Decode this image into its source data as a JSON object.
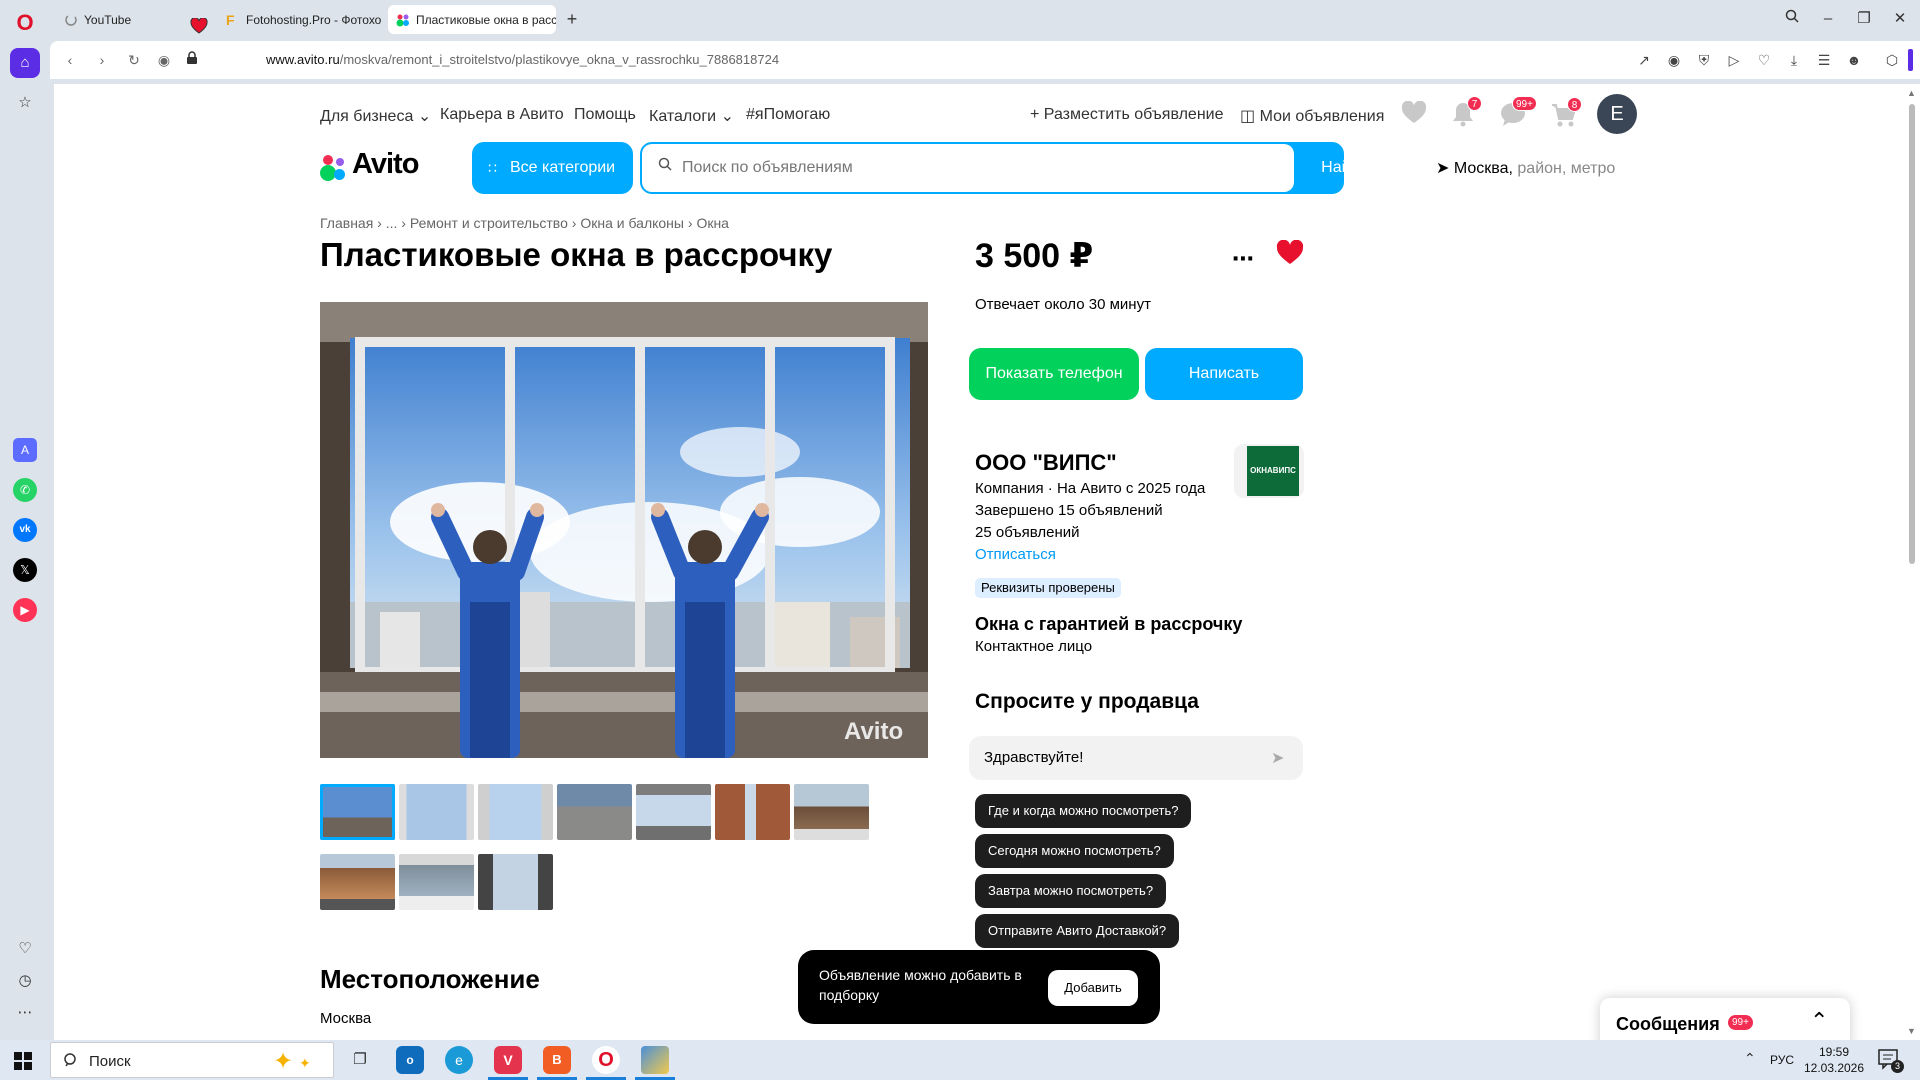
{
  "browser": {
    "tabs": [
      {
        "title": "YouTube"
      },
      {
        "title": "Fotohosting.Pro - Фотохо"
      },
      {
        "title": "Пластиковые окна в расс"
      }
    ],
    "url_domain": "www.avito.ru",
    "url_path": "/moskva/remont_i_stroitelstvo/plastikovye_okna_v_rassrochku_7886818724"
  },
  "header": {
    "nav": [
      "Для бизнеса",
      "Карьера в Авито",
      "Помощь",
      "Каталоги",
      "#яПомогаю"
    ],
    "post_ad": "Разместить объявление",
    "my_ads": "Мои объявления",
    "notifications_count": "7",
    "messages_count": "99+",
    "cart_count": "8",
    "avatar_letter": "E",
    "logo": "Avito",
    "all_categories": "Все категории",
    "search_placeholder": "Поиск по объявлениям",
    "search_button": "Найти",
    "location_city": "Москва,",
    "location_hint": "район, метро"
  },
  "breadcrumbs": [
    "Главная",
    "...",
    "Ремонт и строительство",
    "Окна и балконы",
    "Окна"
  ],
  "listing": {
    "title": "Пластиковые окна в рассрочку",
    "photo_watermark": "Avito",
    "location_heading": "Местоположение",
    "location_city": "Москва"
  },
  "sidebar_info": {
    "price": "3 500 ₽",
    "response_time": "Отвечает около 30 минут",
    "show_phone": "Показать телефон",
    "write": "Написать",
    "seller_name": "ООО \"ВИПС\"",
    "seller_type": "Компания · На Авито с 2025 года",
    "completed": "Завершено 15 объявлений",
    "ads_count": "25 объявлений",
    "unsubscribe": "Отписаться",
    "verified_badge": "Реквизиты проверены",
    "seller_logo_text": "ОКНАВИПС",
    "contact_title": "Окна с гарантией в рассрочку",
    "contact_role": "Контактное лицо",
    "ask_heading": "Спросите у продавца",
    "message_value": "Здравствуйте!",
    "quick_questions": [
      "Где и когда можно посмотреть?",
      "Сегодня можно посмотреть?",
      "Завтра можно посмотреть?",
      "Отправите Авито Доставкой?"
    ]
  },
  "toast": {
    "text": "Объявление можно добавить в подборку",
    "button": "Добавить"
  },
  "messenger": {
    "title": "Сообщения",
    "count": "99+"
  },
  "taskbar": {
    "search": "Поиск",
    "lang": "РУС",
    "time": "19:59",
    "date": "12.03.2026",
    "notif_count": "3"
  },
  "colors": {
    "avito_blue": "#00aaff",
    "avito_green": "#02d15c",
    "badge_red": "#f22d52",
    "favorite_red": "#e8112d"
  }
}
